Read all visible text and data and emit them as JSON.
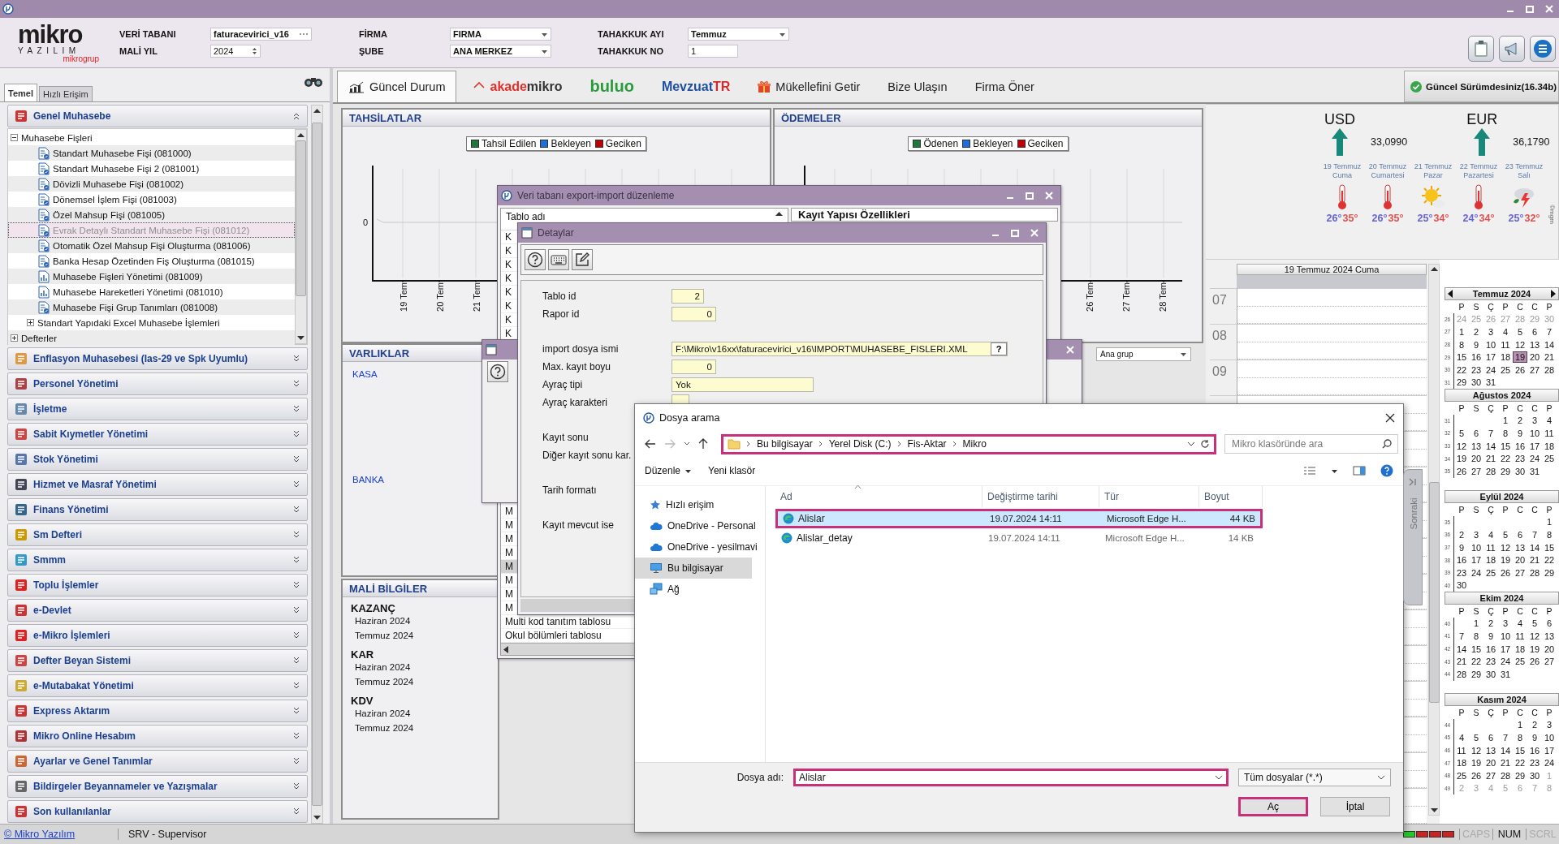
{
  "header": {
    "logo": {
      "name": "mikro",
      "subtitle": "YAZILIM",
      "group": "mikrogrup"
    },
    "fields": [
      {
        "label": "VERİ TABANI",
        "value": "faturacevirici_v16",
        "kind": "browse"
      },
      {
        "label": "FİRMA",
        "value": "FIRMA",
        "kind": "combo"
      },
      {
        "label": "TAHAKKUK AYI",
        "value": "Temmuz",
        "kind": "combo"
      },
      {
        "label": "MALİ YIL",
        "value": "2024",
        "kind": "spin"
      },
      {
        "label": "ŞUBE",
        "value": "ANA MERKEZ",
        "kind": "combo"
      },
      {
        "label": "TAHAKKUK NO",
        "value": "1",
        "kind": "text"
      }
    ]
  },
  "sidebar": {
    "tabs": [
      {
        "label": "Temel",
        "selected": true
      },
      {
        "label": "Hızlı Erişim",
        "selected": false
      }
    ],
    "sections": [
      {
        "label": "Genel Muhasebe",
        "expanded": true,
        "tree": [
          {
            "label": "Muhasebe Fişleri",
            "kind": "folder",
            "expanded": true,
            "selected": false,
            "children": [
              {
                "label": "Standart Muhasebe Fişi (081000)",
                "kind": "form",
                "selected": false
              },
              {
                "label": "Standart Muhasebe Fişi 2 (081001)",
                "kind": "form",
                "selected": false
              },
              {
                "label": "Dövizli Muhasebe Fişi (081002)",
                "kind": "form",
                "selected": false
              },
              {
                "label": "Dönemsel İşlem Fişi (081003)",
                "kind": "form",
                "selected": false
              },
              {
                "label": "Özel Mahsup Fişi (081005)",
                "kind": "form",
                "selected": false
              },
              {
                "label": "Evrak Detaylı Standart Muhasebe Fişi (081012)",
                "kind": "form",
                "selected": true
              },
              {
                "label": "Otomatik Özel Mahsup Fişi Oluşturma (081006)",
                "kind": "form",
                "selected": false
              },
              {
                "label": "Banka Hesap Özetinden Fiş Oluşturma (081015)",
                "kind": "form",
                "selected": false
              },
              {
                "label": "Muhasebe Fişleri Yönetimi (081009)",
                "kind": "report",
                "selected": false
              },
              {
                "label": "Muhasebe Hareketleri Yönetimi (081010)",
                "kind": "report",
                "selected": false
              },
              {
                "label": "Muhasebe Fişi Grup Tanımları (081008)",
                "kind": "form",
                "selected": false
              },
              {
                "label": "Standart Yapıdaki Excel Muhasebe İşlemleri",
                "kind": "folder",
                "expanded": false,
                "selected": false
              }
            ]
          },
          {
            "label": "Defterler",
            "kind": "folder",
            "expanded": false,
            "selected": false
          }
        ]
      },
      {
        "label": "Enflasyon Muhasebesi (Ias-29 ve Spk Uyumlu)",
        "expanded": false
      },
      {
        "label": "Personel Yönetimi",
        "expanded": false
      },
      {
        "label": "İşletme",
        "expanded": false
      },
      {
        "label": "Sabit Kıymetler Yönetimi",
        "expanded": false
      },
      {
        "label": "Stok Yönetimi",
        "expanded": false
      },
      {
        "label": "Hizmet ve Masraf Yönetimi",
        "expanded": false
      },
      {
        "label": "Finans Yönetimi",
        "expanded": false
      },
      {
        "label": "Sm Defteri",
        "expanded": false
      },
      {
        "label": "Smmm",
        "expanded": false
      },
      {
        "label": "Toplu İşlemler",
        "expanded": false
      },
      {
        "label": "e-Devlet",
        "expanded": false
      },
      {
        "label": "e-Mikro İşlemleri",
        "expanded": false
      },
      {
        "label": "Defter Beyan Sistemi",
        "expanded": false
      },
      {
        "label": "e-Mutabakat Yönetimi",
        "expanded": false
      },
      {
        "label": "Express Aktarım",
        "expanded": false
      },
      {
        "label": "Mikro Online Hesabım",
        "expanded": false
      },
      {
        "label": "Ayarlar ve Genel Tanımlar",
        "expanded": false
      },
      {
        "label": "Bildirgeler Beyannameler ve Yazışmalar",
        "expanded": false
      },
      {
        "label": "Son kullanılanlar",
        "expanded": false
      }
    ]
  },
  "tabbar": {
    "tabs": [
      {
        "kind": "dashboard",
        "label": "Güncel Durum",
        "selected": true
      },
      {
        "kind": "logo",
        "parts": [
          {
            "text": "akade",
            "color": "#e0302b"
          },
          {
            "text": "mikro",
            "color": "#333333"
          }
        ],
        "selected": false
      },
      {
        "kind": "logo",
        "parts": [
          {
            "text": "buluo",
            "color": "#2b9a3c"
          }
        ],
        "selected": false
      },
      {
        "kind": "logo",
        "parts": [
          {
            "text": "Mevzuat",
            "color": "#1f4fa0"
          },
          {
            "text": "TR",
            "color": "#d62a2a"
          }
        ],
        "selected": false
      },
      {
        "kind": "gift",
        "label": "Mükellefini Getir",
        "selected": false
      },
      {
        "kind": "link",
        "label": "Bize Ulaşın",
        "selected": false
      },
      {
        "kind": "link",
        "label": "Firma Öner",
        "selected": false
      }
    ],
    "version": "Güncel Sürümdesiniz(16.34b)"
  },
  "charts": [
    {
      "title": "TAHSİLATLAR",
      "legend": [
        {
          "label": "Tahsil Edilen",
          "color": "#1a7a3a"
        },
        {
          "label": "Bekleyen",
          "color": "#1e6fd9"
        },
        {
          "label": "Geciken",
          "color": "#c00000"
        }
      ],
      "y_tick": "0",
      "x_labels": [
        "19 Tem",
        "20 Tem",
        "21 Tem"
      ],
      "labels_at_end": false
    },
    {
      "title": "ÖDEMELER",
      "legend": [
        {
          "label": "Ödenen",
          "color": "#1a7a3a"
        },
        {
          "label": "Bekleyen",
          "color": "#1e6fd9"
        },
        {
          "label": "Geciken",
          "color": "#c00000"
        }
      ],
      "x_labels": [
        "26 Tem",
        "27 Tem",
        "28 Tem"
      ],
      "labels_at_end": true
    }
  ],
  "assets": {
    "title": "VARLIKLAR",
    "items": [
      "KASA",
      "BANKA"
    ]
  },
  "finance": {
    "title": "MALİ BİLGİLER",
    "groups": [
      {
        "title": "KAZANÇ",
        "items": [
          "Haziran 2024",
          "Temmuz 2024"
        ]
      },
      {
        "title": "KAR",
        "items": [
          "Haziran 2024",
          "Temmuz 2024"
        ]
      },
      {
        "title": "KDV",
        "items": [
          "Haziran 2024",
          "Temmuz 2024"
        ]
      }
    ]
  },
  "currencies": [
    {
      "code": "USD",
      "rate": "33,0990"
    },
    {
      "code": "EUR",
      "rate": "36,1790"
    }
  ],
  "weather": {
    "days": [
      {
        "date": "19 Temmuz",
        "day": "Cuma",
        "kind": "hot",
        "low": "26°",
        "high": "35°"
      },
      {
        "date": "20 Temmuz",
        "day": "Cumartesi",
        "kind": "hot",
        "low": "26°",
        "high": "35°"
      },
      {
        "date": "21 Temmuz",
        "day": "Pazar",
        "kind": "sunny",
        "low": "25°",
        "high": "34°"
      },
      {
        "date": "22 Temmuz",
        "day": "Pazartesi",
        "kind": "hot",
        "low": "24°",
        "high": "34°"
      },
      {
        "date": "23 Temmuz",
        "day": "Salı",
        "kind": "storm",
        "low": "25°",
        "high": "32°"
      }
    ],
    "credit": "©mgm"
  },
  "planner": {
    "header": "19 Temmuz 2024 Cuma",
    "hours": [
      "07",
      "08",
      "09"
    ],
    "side_tab": "Sonraki"
  },
  "months": [
    {
      "title": "Temmuz 2024",
      "nav": true,
      "weekdays": [
        "P",
        "S",
        "Ç",
        "P",
        "C",
        "C",
        "P"
      ],
      "weeks": [
        {
          "no": "26",
          "prev": [
            "24",
            "25",
            "26",
            "27",
            "28",
            "29",
            "30"
          ]
        },
        {
          "no": "27",
          "days": [
            {
              "day": "1",
              "selected": false
            },
            {
              "day": "2",
              "selected": false
            },
            {
              "day": "3",
              "selected": false
            },
            {
              "day": "4",
              "selected": false
            },
            {
              "day": "5",
              "selected": false
            },
            {
              "day": "6",
              "selected": false
            },
            {
              "day": "7",
              "selected": false
            }
          ]
        },
        {
          "no": "28",
          "days": [
            {
              "day": "8",
              "selected": false
            },
            {
              "day": "9",
              "selected": false
            },
            {
              "day": "10",
              "selected": false
            },
            {
              "day": "11",
              "selected": false
            },
            {
              "day": "12",
              "selected": false
            },
            {
              "day": "13",
              "selected": false
            },
            {
              "day": "14",
              "selected": false
            }
          ]
        },
        {
          "no": "29",
          "days": [
            {
              "day": "15",
              "selected": false
            },
            {
              "day": "16",
              "selected": false
            },
            {
              "day": "17",
              "selected": false
            },
            {
              "day": "18",
              "selected": false
            },
            {
              "day": "19",
              "selected": true
            },
            {
              "day": "20",
              "selected": false
            },
            {
              "day": "21",
              "selected": false
            }
          ]
        },
        {
          "no": "30",
          "days": [
            {
              "day": "22",
              "selected": false
            },
            {
              "day": "23",
              "selected": false
            },
            {
              "day": "24",
              "selected": false
            },
            {
              "day": "25",
              "selected": false
            },
            {
              "day": "26",
              "selected": false
            },
            {
              "day": "27",
              "selected": false
            },
            {
              "day": "28",
              "selected": false
            }
          ]
        },
        {
          "no": "31",
          "days": [
            {
              "day": "29",
              "selected": false
            },
            {
              "day": "30",
              "selected": false
            },
            {
              "day": "31",
              "selected": false
            }
          ]
        }
      ]
    },
    {
      "title": "Ağustos 2024",
      "nav": false,
      "weekdays": [
        "P",
        "S",
        "Ç",
        "P",
        "C",
        "C",
        "P"
      ],
      "weeks": [
        {
          "no": "31",
          "days": [
            {
              "day": "1",
              "selected": false
            },
            {
              "day": "2",
              "selected": false
            },
            {
              "day": "3",
              "selected": false
            },
            {
              "day": "4",
              "selected": false
            }
          ]
        },
        {
          "no": "32",
          "days": [
            {
              "day": "5",
              "selected": false
            },
            {
              "day": "6",
              "selected": false
            },
            {
              "day": "7",
              "selected": false
            },
            {
              "day": "8",
              "selected": false
            },
            {
              "day": "9",
              "selected": false
            },
            {
              "day": "10",
              "selected": false
            },
            {
              "day": "11",
              "selected": false
            }
          ]
        },
        {
          "no": "33",
          "days": [
            {
              "day": "12",
              "selected": false
            },
            {
              "day": "13",
              "selected": false
            },
            {
              "day": "14",
              "selected": false
            },
            {
              "day": "15",
              "selected": false
            },
            {
              "day": "16",
              "selected": false
            },
            {
              "day": "17",
              "selected": false
            },
            {
              "day": "18",
              "selected": false
            }
          ]
        },
        {
          "no": "34",
          "days": [
            {
              "day": "19",
              "selected": false
            },
            {
              "day": "20",
              "selected": false
            },
            {
              "day": "21",
              "selected": false
            },
            {
              "day": "22",
              "selected": false
            },
            {
              "day": "23",
              "selected": false
            },
            {
              "day": "24",
              "selected": false
            },
            {
              "day": "25",
              "selected": false
            }
          ]
        },
        {
          "no": "35",
          "days": [
            {
              "day": "26",
              "selected": false
            },
            {
              "day": "27",
              "selected": false
            },
            {
              "day": "28",
              "selected": false
            },
            {
              "day": "29",
              "selected": false
            },
            {
              "day": "30",
              "selected": false
            },
            {
              "day": "31",
              "selected": false
            }
          ]
        }
      ]
    },
    {
      "title": "Eylül 2024",
      "nav": false,
      "weekdays": [
        "P",
        "S",
        "Ç",
        "P",
        "C",
        "C",
        "P"
      ],
      "weeks": [
        {
          "no": "35",
          "days": [
            {
              "day": "1",
              "selected": false
            }
          ]
        },
        {
          "no": "36",
          "days": [
            {
              "day": "2",
              "selected": false
            },
            {
              "day": "3",
              "selected": false
            },
            {
              "day": "4",
              "selected": false
            },
            {
              "day": "5",
              "selected": false
            },
            {
              "day": "6",
              "selected": false
            },
            {
              "day": "7",
              "selected": false
            },
            {
              "day": "8",
              "selected": false
            }
          ]
        },
        {
          "no": "37",
          "days": [
            {
              "day": "9",
              "selected": false
            },
            {
              "day": "10",
              "selected": false
            },
            {
              "day": "11",
              "selected": false
            },
            {
              "day": "12",
              "selected": false
            },
            {
              "day": "13",
              "selected": false
            },
            {
              "day": "14",
              "selected": false
            },
            {
              "day": "15",
              "selected": false
            }
          ]
        },
        {
          "no": "38",
          "days": [
            {
              "day": "16",
              "selected": false
            },
            {
              "day": "17",
              "selected": false
            },
            {
              "day": "18",
              "selected": false
            },
            {
              "day": "19",
              "selected": false
            },
            {
              "day": "20",
              "selected": false
            },
            {
              "day": "21",
              "selected": false
            },
            {
              "day": "22",
              "selected": false
            }
          ]
        },
        {
          "no": "39",
          "days": [
            {
              "day": "23",
              "selected": false
            },
            {
              "day": "24",
              "selected": false
            },
            {
              "day": "25",
              "selected": false
            },
            {
              "day": "26",
              "selected": false
            },
            {
              "day": "27",
              "selected": false
            },
            {
              "day": "28",
              "selected": false
            },
            {
              "day": "29",
              "selected": false
            }
          ]
        },
        {
          "no": "40",
          "days": [
            {
              "day": "30",
              "selected": false
            }
          ]
        }
      ]
    },
    {
      "title": "Ekim 2024",
      "nav": false,
      "weekdays": [
        "P",
        "S",
        "Ç",
        "P",
        "C",
        "C",
        "P"
      ],
      "weeks": [
        {
          "no": "40",
          "days": [
            {
              "day": "1",
              "selected": false
            },
            {
              "day": "2",
              "selected": false
            },
            {
              "day": "3",
              "selected": false
            },
            {
              "day": "4",
              "selected": false
            },
            {
              "day": "5",
              "selected": false
            },
            {
              "day": "6",
              "selected": false
            }
          ]
        },
        {
          "no": "41",
          "days": [
            {
              "day": "7",
              "selected": false
            },
            {
              "day": "8",
              "selected": false
            },
            {
              "day": "9",
              "selected": false
            },
            {
              "day": "10",
              "selected": false
            },
            {
              "day": "11",
              "selected": false
            },
            {
              "day": "12",
              "selected": false
            },
            {
              "day": "13",
              "selected": false
            }
          ]
        },
        {
          "no": "42",
          "days": [
            {
              "day": "14",
              "selected": false
            },
            {
              "day": "15",
              "selected": false
            },
            {
              "day": "16",
              "selected": false
            },
            {
              "day": "17",
              "selected": false
            },
            {
              "day": "18",
              "selected": false
            },
            {
              "day": "19",
              "selected": false
            },
            {
              "day": "20",
              "selected": false
            }
          ]
        },
        {
          "no": "43",
          "days": [
            {
              "day": "21",
              "selected": false
            },
            {
              "day": "22",
              "selected": false
            },
            {
              "day": "23",
              "selected": false
            },
            {
              "day": "24",
              "selected": false
            },
            {
              "day": "25",
              "selected": false
            },
            {
              "day": "26",
              "selected": false
            },
            {
              "day": "27",
              "selected": false
            }
          ]
        },
        {
          "no": "44",
          "days": [
            {
              "day": "28",
              "selected": false
            },
            {
              "day": "29",
              "selected": false
            },
            {
              "day": "30",
              "selected": false
            },
            {
              "day": "31",
              "selected": false
            }
          ]
        }
      ]
    },
    {
      "title": "Kasım 2024",
      "nav": false,
      "weekdays": [
        "P",
        "S",
        "Ç",
        "P",
        "C",
        "C",
        "P"
      ],
      "weeks": [
        {
          "no": "44",
          "days": [
            {
              "day": "1",
              "selected": false
            },
            {
              "day": "2",
              "selected": false
            },
            {
              "day": "3",
              "selected": false
            }
          ]
        },
        {
          "no": "45",
          "days": [
            {
              "day": "4",
              "selected": false
            },
            {
              "day": "5",
              "selected": false
            },
            {
              "day": "6",
              "selected": false
            },
            {
              "day": "7",
              "selected": false
            },
            {
              "day": "8",
              "selected": false
            },
            {
              "day": "9",
              "selected": false
            },
            {
              "day": "10",
              "selected": false
            }
          ]
        },
        {
          "no": "46",
          "days": [
            {
              "day": "11",
              "selected": false
            },
            {
              "day": "12",
              "selected": false
            },
            {
              "day": "13",
              "selected": false
            },
            {
              "day": "14",
              "selected": false
            },
            {
              "day": "15",
              "selected": false
            },
            {
              "day": "16",
              "selected": false
            },
            {
              "day": "17",
              "selected": false
            }
          ]
        },
        {
          "no": "47",
          "days": [
            {
              "day": "18",
              "selected": false
            },
            {
              "day": "19",
              "selected": false
            },
            {
              "day": "20",
              "selected": false
            },
            {
              "day": "21",
              "selected": false
            },
            {
              "day": "22",
              "selected": false
            },
            {
              "day": "23",
              "selected": false
            },
            {
              "day": "24",
              "selected": false
            }
          ]
        },
        {
          "no": "48",
          "days": [
            {
              "day": "25",
              "selected": false
            },
            {
              "day": "26",
              "selected": false
            },
            {
              "day": "27",
              "selected": false
            },
            {
              "day": "28",
              "selected": false
            },
            {
              "day": "29",
              "selected": false
            },
            {
              "day": "30",
              "selected": false
            }
          ],
          "next": [
            "1"
          ]
        },
        {
          "no": "49",
          "next": [
            "2",
            "3",
            "4",
            "5",
            "6",
            "7",
            "8"
          ]
        }
      ]
    }
  ],
  "export_window": {
    "title": "Veri tabanı export-import düzenleme",
    "list_header": "Tablo adı",
    "properties_title": "Kayıt Yapısı Özellikleri",
    "rows_top": [
      {
        "text": "K",
        "selected": false
      },
      {
        "text": "K",
        "selected": false
      },
      {
        "text": "K",
        "selected": false
      },
      {
        "text": "K",
        "selected": false
      },
      {
        "text": "K",
        "selected": false
      },
      {
        "text": "K",
        "selected": false
      },
      {
        "text": "K",
        "selected": false
      },
      {
        "text": "K",
        "selected": false
      }
    ],
    "rows_bottom": [
      {
        "text": "M",
        "selected": false
      },
      {
        "text": "M",
        "selected": false
      },
      {
        "text": "M",
        "selected": false
      },
      {
        "text": "M",
        "selected": false
      },
      {
        "text": "M",
        "selected": true
      },
      {
        "text": "M",
        "selected": false
      },
      {
        "text": "M",
        "selected": false
      },
      {
        "text": "M",
        "selected": false
      },
      {
        "text": "Multi kod tanıtım tablosu",
        "selected": false
      },
      {
        "text": "Okul bölümleri tablosu",
        "selected": false
      }
    ]
  },
  "group_window": {
    "dropdown": "Ana grup"
  },
  "details_window": {
    "title": "Detaylar",
    "field_groups": [
      [
        {
          "label": "Tablo id",
          "value": "2",
          "kind": "number"
        },
        {
          "label": "Rapor id",
          "value": "0",
          "kind": "number"
        }
      ],
      [
        {
          "label": "import dosya ismi",
          "value": "F:\\Mikro\\v16xx\\faturacevirici_v16\\IMPORT\\MUHASEBE_FISLERI.XML",
          "kind": "file",
          "button": "?"
        },
        {
          "label": "Max. kayıt boyu",
          "value": "0",
          "kind": "number"
        },
        {
          "label": "Ayraç tipi",
          "value": "Yok",
          "kind": "text"
        },
        {
          "label": "Ayraç karakteri",
          "kind": "char"
        }
      ],
      [
        {
          "label": "Kayıt sonu",
          "kind": "label"
        },
        {
          "label": "Diğer kayıt sonu kar.",
          "kind": "label"
        }
      ],
      [
        {
          "label": "Tarih formatı",
          "kind": "label"
        }
      ],
      [
        {
          "label": "Kayıt mevcut ise",
          "kind": "label"
        }
      ]
    ]
  },
  "file_dialog": {
    "title": "Dosya arama",
    "address": {
      "parts": [
        "Bu bilgisayar",
        "Yerel Disk (C:)",
        "Fis-Aktar",
        "Mikro"
      ],
      "highlighted": true
    },
    "search_placeholder": "Mikro klasöründe ara",
    "toolbar": [
      {
        "label": "Düzenle",
        "menu": true
      },
      {
        "label": "Yeni klasör",
        "menu": false
      }
    ],
    "nav": [
      {
        "label": "Hızlı erişim",
        "kind": "star",
        "selected": false
      },
      {
        "label": "OneDrive - Personal",
        "kind": "cloud",
        "selected": false
      },
      {
        "label": "OneDrive - yesilmavi",
        "kind": "cloud",
        "selected": false
      },
      {
        "label": "Bu bilgisayar",
        "kind": "pc",
        "selected": true
      },
      {
        "label": "Ağ",
        "kind": "network",
        "selected": false
      }
    ],
    "columns": [
      "Ad",
      "Değiştirme tarihi",
      "Tür",
      "Boyut"
    ],
    "files": [
      {
        "name": "Alislar",
        "date": "19.07.2024 14:11",
        "type": "Microsoft Edge H...",
        "size": "44 KB",
        "selected": true,
        "highlighted": true
      },
      {
        "name": "Alislar_detay",
        "date": "19.07.2024 14:11",
        "type": "Microsoft Edge H...",
        "size": "14 KB",
        "selected": false,
        "highlighted": false
      }
    ],
    "filename": {
      "label": "Dosya adı:",
      "value": "Alislar",
      "highlighted": true
    },
    "filter": "Tüm dosyalar (*.*)",
    "buttons": [
      {
        "label": "Aç",
        "highlighted": true
      },
      {
        "label": "İptal",
        "highlighted": false
      }
    ]
  },
  "status_bar": {
    "link": "© Mikro Yazılım",
    "user": "SRV - Supervisor",
    "leds": [
      {
        "on": true
      },
      {
        "on": false
      },
      {
        "on": false
      },
      {
        "on": false
      }
    ],
    "indicators": [
      {
        "label": "CAPS",
        "on": false
      },
      {
        "label": "NUM",
        "on": true
      },
      {
        "label": "SCRL",
        "on": false
      }
    ]
  }
}
